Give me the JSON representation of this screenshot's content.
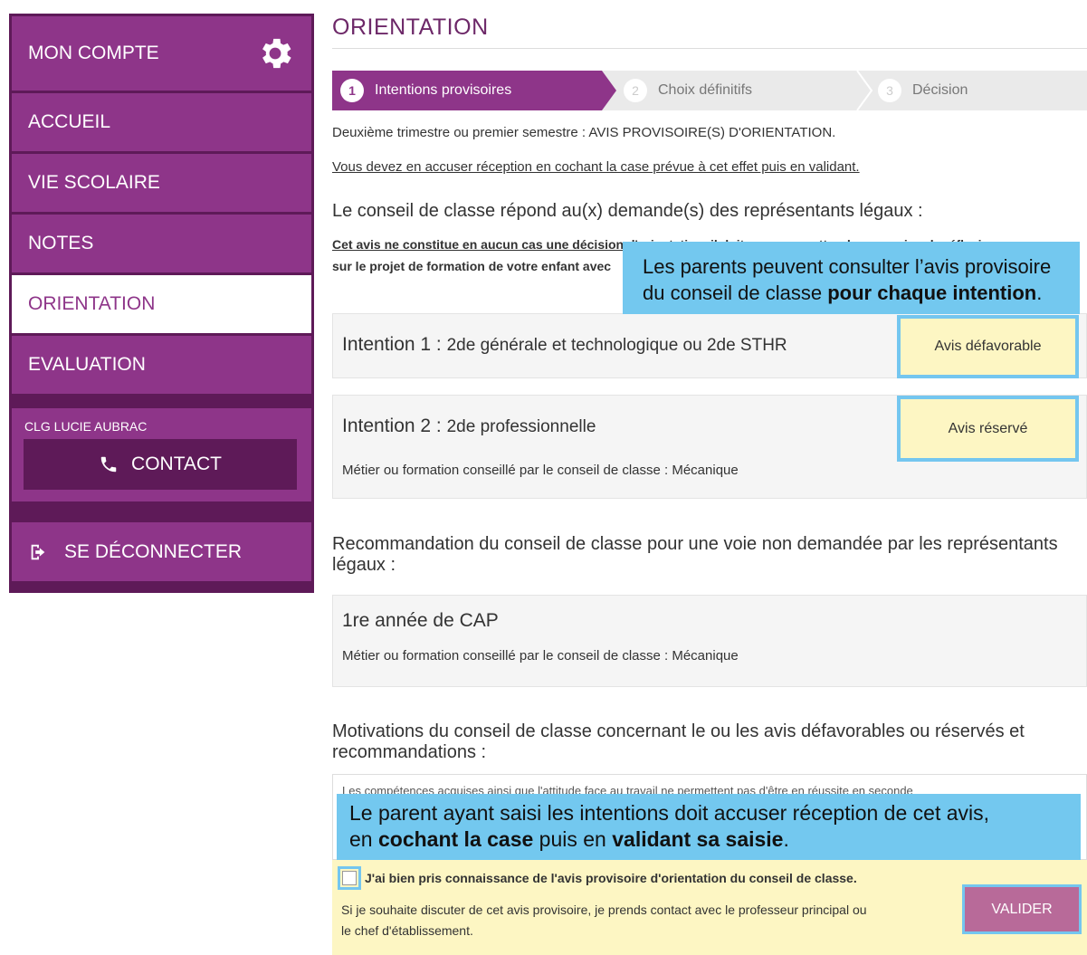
{
  "sidebar": {
    "account_label": "MON COMPTE",
    "items": [
      {
        "label": "ACCUEIL"
      },
      {
        "label": "VIE SCOLAIRE"
      },
      {
        "label": "NOTES"
      },
      {
        "label": "ORIENTATION"
      },
      {
        "label": "EVALUATION"
      }
    ],
    "school_name": "CLG LUCIE AUBRAC",
    "contact_label": "CONTACT",
    "logout_label": "SE DÉCONNECTER"
  },
  "main": {
    "title": "ORIENTATION",
    "steps": [
      {
        "num": "1",
        "label": "Intentions provisoires"
      },
      {
        "num": "2",
        "label": "Choix définitifs"
      },
      {
        "num": "3",
        "label": "Décision"
      }
    ],
    "info_line": "Deuxième trimestre ou premier semestre : AVIS PROVISOIRE(S) D'ORIENTATION.",
    "ack_instruction": "Vous devez en accuser réception en cochant la case prévue à cet effet puis en validant.",
    "council_heading": "Le conseil de classe répond au(x) demande(s) des représentants légaux :",
    "disclaimer_line1": "Cet avis ne constitue en aucun cas une décision d'orientation, il doit vous permettre de poursuivre la réflexion",
    "disclaimer_line2": "sur le projet de formation de votre enfant avec",
    "intentions": [
      {
        "title": "Intention 1",
        "value": "2de générale et technologique ou 2de STHR",
        "avis": "Avis défavorable"
      },
      {
        "title": "Intention 2",
        "value": "2de professionnelle",
        "avis": "Avis réservé",
        "conseil": "Métier ou formation conseillé par le conseil de classe : Mécanique"
      }
    ],
    "recommendation_heading_line1": "Recommandation du conseil de classe pour une voie non demandée par les représentants",
    "recommendation_heading_line2": "légaux :",
    "recommendation": {
      "title": "1re année de CAP",
      "conseil": "Métier ou formation conseillé par le conseil de classe : Mécanique"
    },
    "motivations_heading_line1": "Motivations du conseil de classe concernant le ou les avis défavorables ou réservés et",
    "motivations_heading_line2": "recommandations :",
    "motivations_text": "Les compétences acquises ainsi que l'attitude face au travail ne permettent pas d'être en réussite en seconde",
    "checkbox_label": "J'ai bien pris connaissance de l'avis provisoire d'orientation du conseil de classe.",
    "contact_note_line1": "Si je souhaite discuter de cet avis provisoire, je prends contact avec le professeur principal ou",
    "contact_note_line2": "le chef d'établissement.",
    "validate_label": "VALIDER"
  },
  "callouts": {
    "top_line1": "Les parents peuvent consulter l’avis provisoire",
    "top_line2_plain": "du conseil de classe ",
    "top_line2_bold": "pour chaque intention",
    "top_line2_end": ".",
    "bottom_line1": "Le parent ayant saisi les intentions doit accuser réception de cet avis,",
    "bottom_line2_a": "en ",
    "bottom_line2_b": "cochant la case",
    "bottom_line2_c": " puis en ",
    "bottom_line2_d": "validant sa saisie",
    "bottom_line2_e": "."
  },
  "colors": {
    "purple_dark": "#5e1a58",
    "purple": "#8e3589",
    "highlight_blue": "#74c6ef",
    "yellow": "#fdf6c3"
  }
}
